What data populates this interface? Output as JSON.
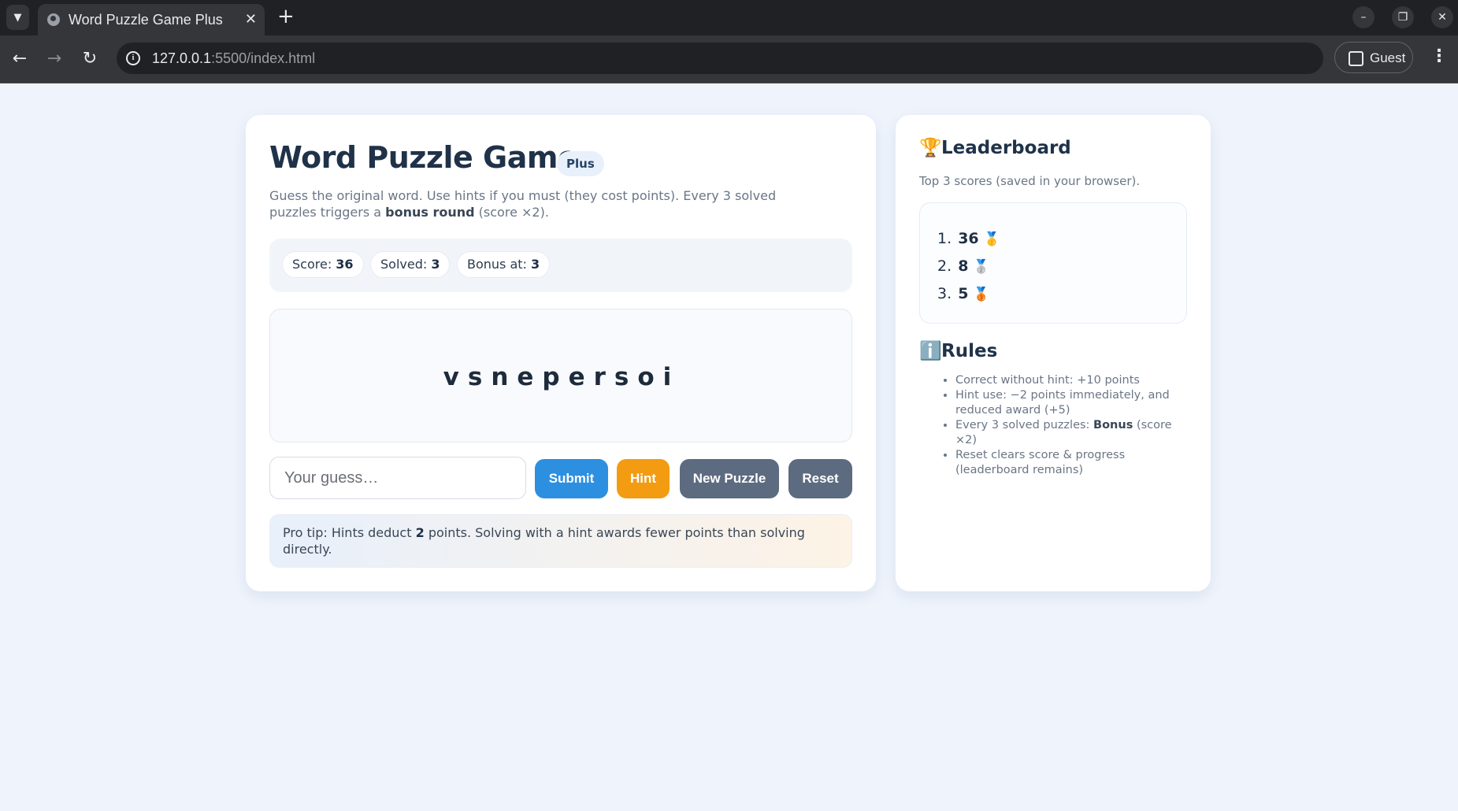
{
  "browser": {
    "tab_title": "Word Puzzle Game Plus",
    "tab_close": "✕",
    "new_tab": "+",
    "url_host": "127.0.0.1",
    "url_path": ":5500/index.html",
    "profile_label": "Guest"
  },
  "header": {
    "title": "Word Puzzle Game",
    "badge": "Plus",
    "subtitle_part1": "Guess the original word. Use hints if you must (they cost points). Every 3 solved puzzles triggers a ",
    "subtitle_bold": "bonus round",
    "subtitle_part2": " (score ×2)."
  },
  "stats": {
    "score_label": "Score: ",
    "score_value": "36",
    "solved_label": "Solved: ",
    "solved_value": "3",
    "bonus_label": "Bonus at: ",
    "bonus_value": "3"
  },
  "puzzle": {
    "scrambled": "vsnepersoi"
  },
  "guess": {
    "placeholder": "Your guess…",
    "value": ""
  },
  "buttons": {
    "submit": "Submit",
    "hint": "Hint",
    "new_puzzle": "New Puzzle",
    "reset": "Reset"
  },
  "tip": {
    "part1": "Pro tip: Hints deduct ",
    "bold": "2",
    "part2": " points. Solving with a hint awards fewer points than solving directly."
  },
  "leaderboard": {
    "icon": "🏆",
    "heading": "Leaderboard",
    "subtitle": "Top 3 scores (saved in your browser).",
    "entries": [
      {
        "rank": "1.",
        "score": "36",
        "medal": "🥇"
      },
      {
        "rank": "2.",
        "score": "8",
        "medal": "🥈"
      },
      {
        "rank": "3.",
        "score": "5",
        "medal": "🥉"
      }
    ]
  },
  "rules": {
    "icon": "ℹ️",
    "heading": "Rules",
    "items": [
      {
        "text": "Correct without hint: +10 points"
      },
      {
        "text": "Hint use: −2 points immediately, and reduced award (+5)"
      },
      {
        "pre": "Every 3 solved puzzles: ",
        "bold": "Bonus",
        "post": " (score ×2)"
      },
      {
        "text": "Reset clears score & progress (leaderboard remains)"
      }
    ]
  },
  "colors": {
    "page_bg": "#eef3fc",
    "submit": "#2d8fe0",
    "hint": "#f39c12",
    "neutral_button": "#5d6b80",
    "title": "#1f3249"
  }
}
